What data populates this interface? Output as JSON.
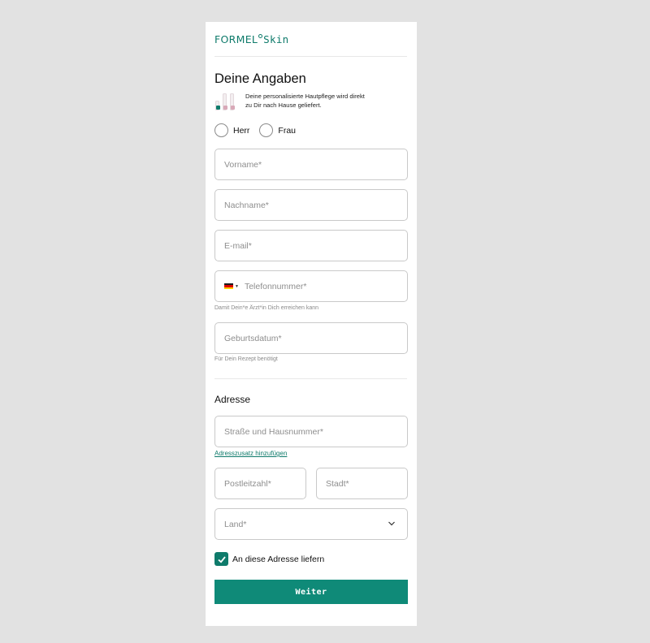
{
  "brand": {
    "name_part1": "FORMEL",
    "name_part2": "Skin",
    "accent_color": "#0f7b6b"
  },
  "page": {
    "title": "Deine Angaben",
    "intro_line1": "Deine personalisierte Hautpflege wird direkt",
    "intro_line2": "zu Dir nach Hause geliefert."
  },
  "salutation": {
    "options": [
      "Herr",
      "Frau"
    ]
  },
  "fields": {
    "first_name": {
      "placeholder": "Vorname*"
    },
    "last_name": {
      "placeholder": "Nachname*"
    },
    "email": {
      "placeholder": "E-mail*"
    },
    "phone": {
      "placeholder": "Telefonnummer*",
      "country_flag": "germany-flag-icon",
      "helper": "Damit Dein*e Ärzt*in Dich erreichen kann"
    },
    "birthdate": {
      "placeholder": "Geburtsdatum*",
      "helper": "Für Dein Rezept benötigt"
    }
  },
  "address": {
    "heading": "Adresse",
    "street": {
      "placeholder": "Straße und Hausnummer*"
    },
    "add_extra_link": "Adresszusatz hinzufügen",
    "postal_code": {
      "placeholder": "Postleitzahl*"
    },
    "city": {
      "placeholder": "Stadt*"
    },
    "country": {
      "placeholder": "Land*"
    },
    "deliver_here": {
      "label": "An diese Adresse liefern",
      "checked": true
    }
  },
  "actions": {
    "submit_label": "Weiter",
    "submit_color": "#0f8a78"
  }
}
